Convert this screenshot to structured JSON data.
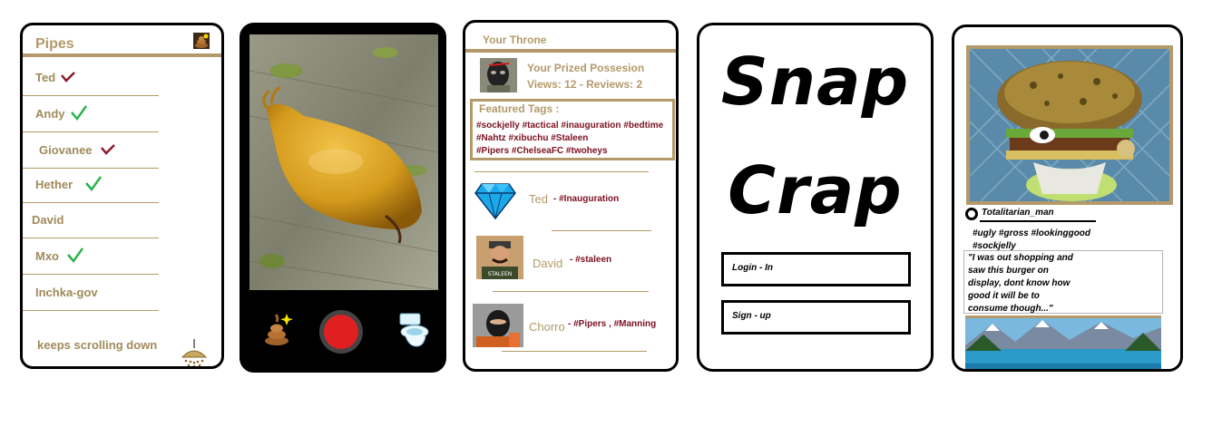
{
  "pipes_screen": {
    "title": "Pipes",
    "contacts": [
      {
        "name": "Ted",
        "status": "checked-dark"
      },
      {
        "name": "Andy",
        "status": "checked-green"
      },
      {
        "name": "Giovanee",
        "status": "checked-dark"
      },
      {
        "name": "Hether",
        "status": "checked-green"
      },
      {
        "name": "David",
        "status": "none"
      },
      {
        "name": "Mxo",
        "status": "checked-green"
      },
      {
        "name": "Inchka-gov",
        "status": "none"
      }
    ],
    "footer_text": "keeps scrolling down",
    "icons": {
      "header": "poop-icon",
      "footer": "shower-icon"
    }
  },
  "camera_screen": {
    "icons": [
      "poop-sparkle-icon",
      "record-button-icon",
      "toilet-icon"
    ],
    "record_color": "#e02020"
  },
  "throne_screen": {
    "title": "Your Throne",
    "prize_label": "Your Prized Possesion",
    "stats": "Views: 12 - Reviews: 2",
    "featured_label": "Featured Tags  :",
    "featured_tags": [
      "#sockjelly #tactical #inauguration #bedtime",
      "#Nahtz #xibuchu #Staleen",
      "#Pipers #ChelseaFC #twoheys"
    ],
    "entries": [
      {
        "name": "Ted",
        "tags": "- #Inauguration"
      },
      {
        "name": "David",
        "tags": "- #staleen"
      },
      {
        "name": "Chorro",
        "tags": "- #Pipers , #Manning"
      }
    ]
  },
  "login_screen": {
    "logo_line1": "Snap",
    "logo_line2": "Crap",
    "login_label": "Login - In",
    "signup_label": "Sign - up"
  },
  "post_screen": {
    "username": "Totalitarian_man",
    "tags_line1": "#ugly #gross #lookinggood",
    "tags_line2": "#sockjelly",
    "caption": [
      "\"I was out shopping and",
      "saw this burger on",
      "display, dont know how",
      "good it will be to",
      "consume though...\""
    ]
  },
  "colors": {
    "accent_tan": "#b49a6a",
    "tag_maroon": "#7a1020",
    "check_green": "#2db34a",
    "check_dark": "#8b1a2a"
  }
}
